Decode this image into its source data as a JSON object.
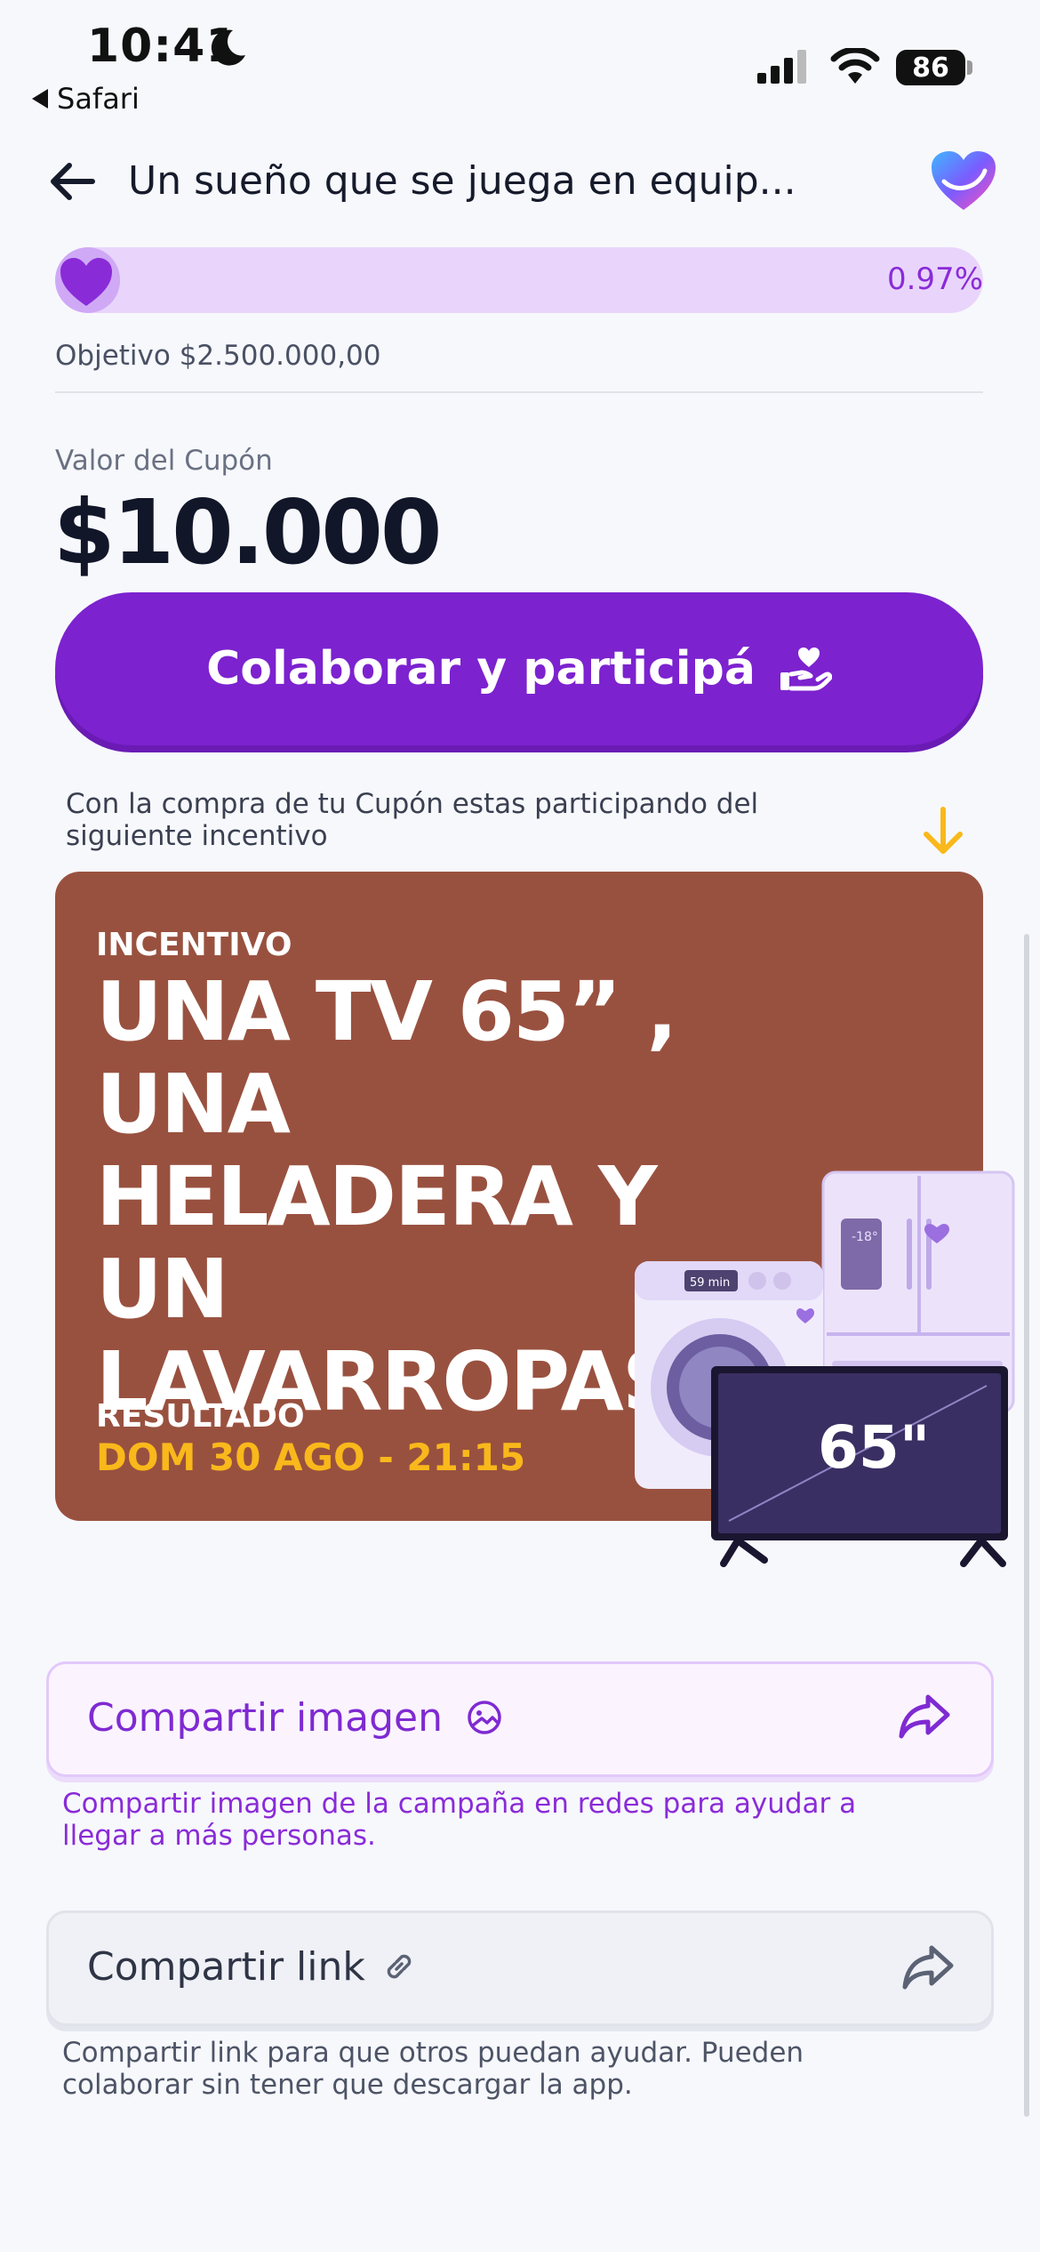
{
  "status_bar": {
    "time": "10:41",
    "back_app": "Safari",
    "battery": "86"
  },
  "header": {
    "title": "Un sueño que se juega en equip..."
  },
  "progress": {
    "percent_label": "0.97%",
    "fraction": 0.0097,
    "goal_text": "Objetivo $2.500.000,00"
  },
  "coupon": {
    "label": "Valor del Cupón",
    "value": "$10.000",
    "button_label": "Colaborar y participá"
  },
  "incentive_note": "Con la compra de tu Cupón estas participando del siguiente incentivo",
  "incentive": {
    "label": "INCENTIVO",
    "title": "UNA TV 65” , UNA HELADERA Y UN LAVARROPAS",
    "result_label": "RESULTADO",
    "result_date": "DOM 30 AGO - 21:15",
    "tv_label": "65\"",
    "washer_display": "59 min",
    "fridge_display": "-18°"
  },
  "share_image": {
    "label": "Compartir imagen",
    "note": "Compartir imagen de la campaña en redes para ayudar a llegar a más personas."
  },
  "share_link": {
    "label": "Compartir link",
    "note": "Compartir link para que otros puedan ayudar. Pueden colaborar sin tener que descargar la app."
  },
  "colors": {
    "primary": "#7c22cf",
    "progress_track": "#e9d5fb",
    "card_bg": "#99513f",
    "accent_yellow": "#f9b81b"
  },
  "icons": [
    "moon-icon",
    "signal-icon",
    "wifi-icon",
    "back-arrow-icon",
    "app-logo-heart-icon",
    "heart-icon",
    "helping-hand-heart-icon",
    "arrow-down-icon",
    "image-icon",
    "share-arrow-icon",
    "link-icon"
  ]
}
